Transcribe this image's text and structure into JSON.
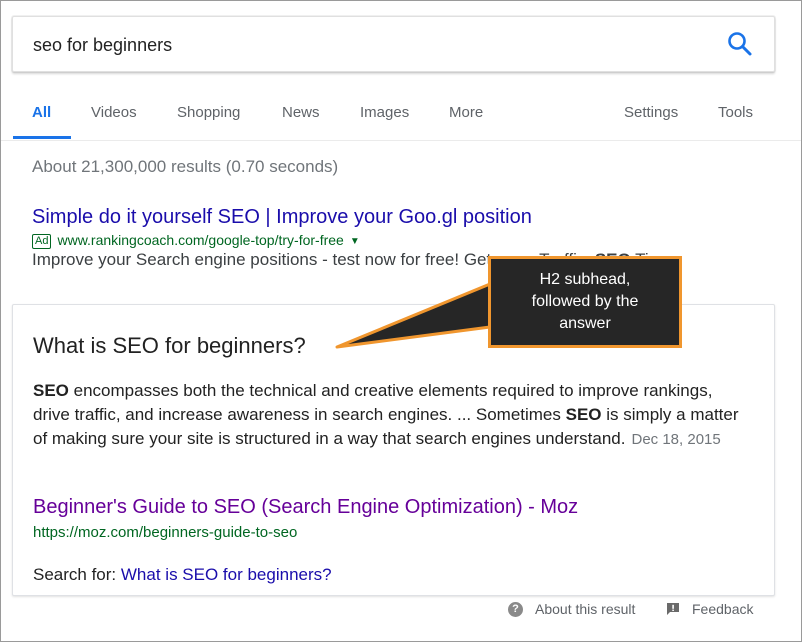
{
  "search": {
    "query": "seo for beginners",
    "icon": "search-icon",
    "accent_color": "#1a73e8"
  },
  "tabs": {
    "all": "All",
    "videos": "Videos",
    "shopping": "Shopping",
    "news": "News",
    "images": "Images",
    "more": "More",
    "settings": "Settings",
    "tools": "Tools"
  },
  "result_stats": "About 21,300,000 results (0.70 seconds)",
  "ad": {
    "title": "Simple do it yourself SEO | Improve your Goo.gl position",
    "badge": "Ad",
    "url": "www.rankingcoach.com/google-top/try-for-free",
    "description_start": "Improve your Search engine positions - test now for fr",
    "description_rest": "ee! Get more Traffic. ",
    "description_bold": "SEO",
    "description_end": " Ti…"
  },
  "featured_snippet": {
    "question": "What is SEO for beginners?",
    "body": [
      {
        "b": "SEO"
      },
      {
        "t": " encompasses both the technical and creative elements required to improve rankings, drive traffic, and increase awareness in search engines. ... Sometimes "
      },
      {
        "b": "SEO"
      },
      {
        "t": " is simply a matter of making sure your site is structured in a way that search engines understand."
      }
    ],
    "date": "Dec 18, 2015",
    "source_title": "Beginner's Guide to SEO (Search Engine Optimization) - Moz",
    "source_url": "https://moz.com/beginners-guide-to-seo",
    "search_for_label": "Search for:",
    "search_for_link": "What is SEO for beginners?"
  },
  "footer": {
    "about": "About this result",
    "feedback": "Feedback"
  },
  "callout": {
    "text_lines": [
      "H2 subhead,",
      "followed by the",
      "answer"
    ],
    "border_color": "#f0962e",
    "background": "#262626"
  }
}
